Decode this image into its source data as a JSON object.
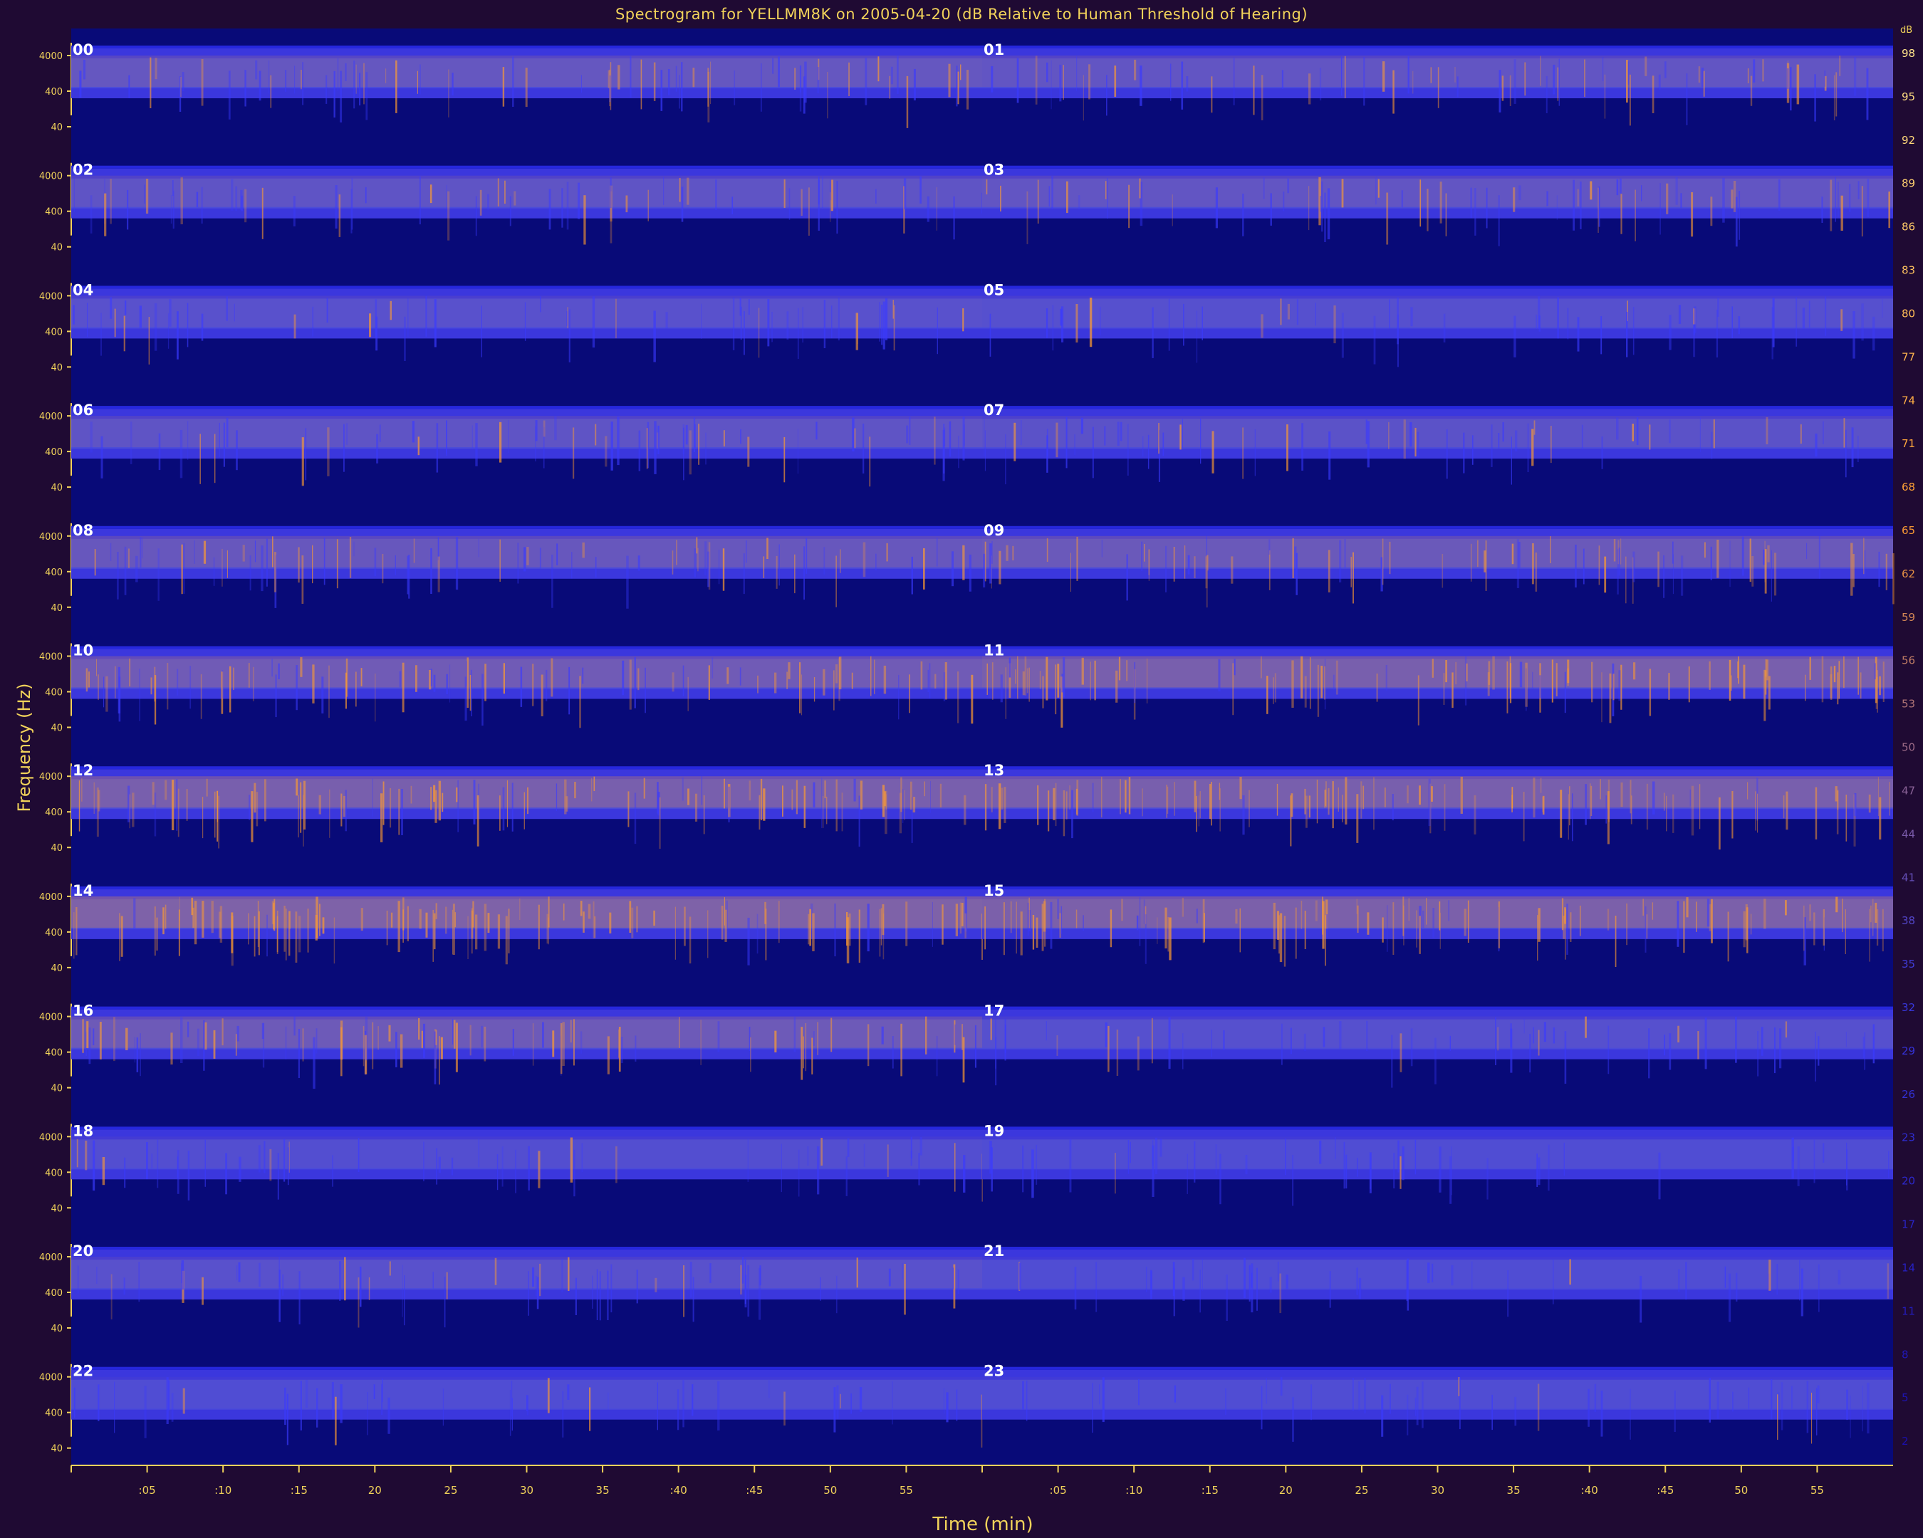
{
  "chart_data": {
    "type": "heatmap",
    "title": "Spectrogram for YELLMM8K on 2005-04-20 (dB Relative to Human Threshold of Hearing)",
    "xlabel": "Time (min)",
    "ylabel": "Frequency (Hz)",
    "freq_ticks": [
      "4000",
      "400",
      "40"
    ],
    "time_ticks": [
      ":05",
      ":10",
      ":15",
      "20",
      "25",
      "30",
      "35",
      ":40",
      ":45",
      "50",
      "55"
    ],
    "hours": [
      "00",
      "01",
      "02",
      "03",
      "04",
      "05",
      "06",
      "07",
      "08",
      "09",
      "10",
      "11",
      "12",
      "13",
      "14",
      "15",
      "16",
      "17",
      "18",
      "19",
      "20",
      "21",
      "22",
      "23"
    ],
    "colorbar": {
      "label": "dB",
      "ticks": [
        98,
        95,
        92,
        89,
        86,
        83,
        80,
        77,
        74,
        71,
        68,
        65,
        62,
        59,
        56,
        53,
        50,
        47,
        44,
        41,
        38,
        35,
        32,
        29,
        26,
        23,
        20,
        17,
        14,
        11,
        8,
        5,
        2
      ],
      "colors": [
        "#ffe48a",
        "#ff9c2e",
        "#3a3adf",
        "#1a10b0"
      ]
    },
    "band_intensity": [
      0.45,
      0.4,
      0.35,
      0.4,
      0.25,
      0.2,
      0.35,
      0.3,
      0.5,
      0.55,
      0.65,
      0.8,
      0.8,
      0.8,
      0.9,
      0.85,
      0.6,
      0.2,
      0.15,
      0.1,
      0.25,
      0.1,
      0.1,
      0.1
    ],
    "colors": {
      "background": "#1f0a33",
      "plot": "#080a78",
      "band": "#3b37dd",
      "band_core": "#5050d8",
      "hot": "#ff9c2e",
      "axis": "#f2d35a"
    }
  }
}
